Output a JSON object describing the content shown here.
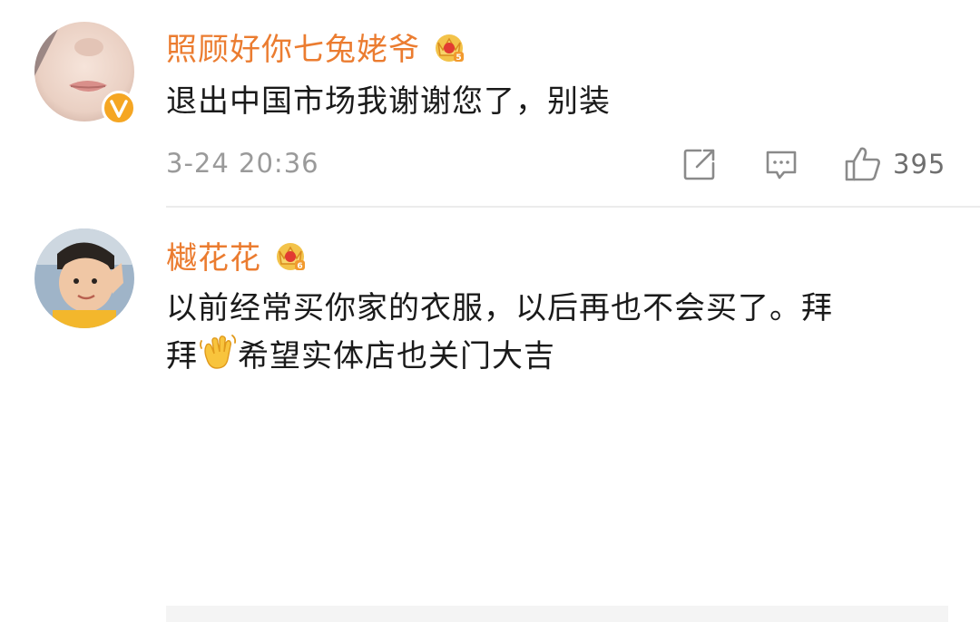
{
  "comments": [
    {
      "username": "照顾好你七兔姥爷",
      "vip_level": "5",
      "text": "退出中国市场我谢谢您了，别装",
      "timestamp": "3-24 20:36",
      "likes": "395",
      "verified": true,
      "icons": [
        "avatar",
        "verified-badge-icon",
        "vip-crown-icon",
        "share-icon",
        "comment-icon",
        "like-icon"
      ]
    },
    {
      "username": "樾花花",
      "vip_level": "6",
      "text_line1": "以前经常买你家的衣服，以后再也不会买了。拜",
      "text_line2_before": "拜",
      "emoji": "wave-hand-emoji",
      "text_line2_after": "希望实体店也关门大吉"
    }
  ],
  "colors": {
    "username": "#eb7c30",
    "text": "#1a1a1a",
    "meta": "#9a9a9a",
    "verified": "#f5a623",
    "divider": "#ececec"
  }
}
